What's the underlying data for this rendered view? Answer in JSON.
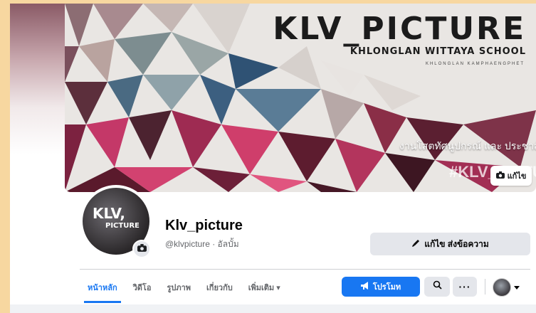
{
  "cover": {
    "title": "KLV_PICTURE",
    "subtitle": "KHLONGLAN WITTAYA SCHOOL",
    "small_text": "KHLONGLAN KAMPHAENGPHET",
    "thai_caption": "งานโสตทัศนูปกรณ์ และ ประชาสัมพัน",
    "hashtag": "#KLV_PICTURE",
    "edit_label": "แก้ไข"
  },
  "profile": {
    "avatar_text": "KLV,",
    "avatar_sub": "PICTURE",
    "name": "Klv_picture",
    "handle": "@klvpicture · อัลบั้ม"
  },
  "actions": {
    "edit_send_label": "แก้ไข ส่งข้อความ",
    "promote_label": "โปรโมท",
    "more_label": "···"
  },
  "tabs": [
    {
      "label": "หน้าหลัก",
      "active": true
    },
    {
      "label": "วิดีโอ",
      "active": false
    },
    {
      "label": "รูปภาพ",
      "active": false
    },
    {
      "label": "เกี่ยวกับ",
      "active": false
    },
    {
      "label": "เพิ่มเติม ▾",
      "active": false
    }
  ],
  "colors": {
    "accent": "#1877f2",
    "button_gray": "#e4e6eb",
    "frame": "#f7d7a0"
  }
}
